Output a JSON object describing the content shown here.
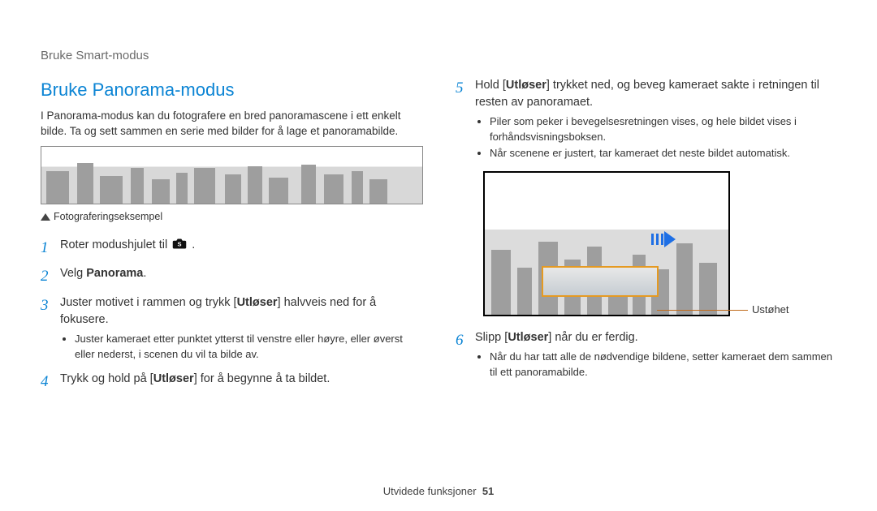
{
  "header": "Bruke Smart-modus",
  "left": {
    "title": "Bruke Panorama-modus",
    "intro": "I Panorama-modus kan du fotografere en bred panoramascene i ett enkelt bilde. Ta og sett sammen en serie med bilder for å lage et panoramabilde.",
    "caption": "Fotograferingseksempel",
    "steps": {
      "1": {
        "num": "1",
        "pre": "Roter modushjulet til ",
        "post": " ."
      },
      "2": {
        "num": "2",
        "pre": "Velg ",
        "bold": "Panorama",
        "post": "."
      },
      "3": {
        "num": "3",
        "pre": "Juster motivet i rammen og trykk [",
        "bold": "Utløser",
        "post": "] halvveis ned for å fokusere.",
        "sub": [
          "Juster kameraet etter punktet ytterst til venstre eller høyre, eller øverst eller nederst, i scenen du vil ta bilde av."
        ]
      },
      "4": {
        "num": "4",
        "pre": "Trykk og hold på [",
        "bold": "Utløser",
        "post": "] for å begynne å ta bildet."
      }
    }
  },
  "right": {
    "steps": {
      "5": {
        "num": "5",
        "pre": "Hold [",
        "bold": "Utløser",
        "post": "] trykket ned, og beveg kameraet sakte i retningen til resten av panoramaet.",
        "sub": [
          "Piler som peker i bevegelsesretningen vises, og hele bildet vises i forhåndsvisningsboksen.",
          "Når scenene er justert, tar kameraet det neste bildet automatisk."
        ]
      },
      "6": {
        "num": "6",
        "pre": "Slipp [",
        "bold": "Utløser",
        "post": "] når du er ferdig.",
        "sub": [
          "Når du har tatt alle de nødvendige bildene, setter kameraet dem sammen til ett panoramabilde."
        ]
      }
    },
    "annotation": "Ustøhet"
  },
  "footer": {
    "section": "Utvidede funksjoner",
    "page": "51"
  },
  "icons": {
    "camera": "camera-icon",
    "triangle": "triangle-up-icon",
    "arrow": "arrow-right-icon"
  }
}
